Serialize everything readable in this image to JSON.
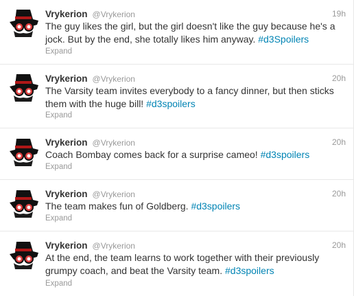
{
  "tweets": [
    {
      "fullname": "Vrykerion",
      "screenname": "@Vrykerion",
      "time": "19h",
      "text": "The guy likes the girl, but the girl doesn't like the guy because he's a jock. But by the end, she totally likes him anyway.",
      "hashtag": "#d3Spoilers",
      "expand_label": "Expand",
      "avatar_icon": "black-hat-sunglasses-avatar"
    },
    {
      "fullname": "Vrykerion",
      "screenname": "@Vrykerion",
      "time": "20h",
      "text": "The Varsity team invites everybody to a fancy dinner, but then sticks them with the huge bill!",
      "hashtag": "#d3spoilers",
      "expand_label": "Expand",
      "avatar_icon": "black-hat-sunglasses-avatar"
    },
    {
      "fullname": "Vrykerion",
      "screenname": "@Vrykerion",
      "time": "20h",
      "text": "Coach Bombay comes back for a surprise cameo!",
      "hashtag": "#d3spoilers",
      "expand_label": "Expand",
      "avatar_icon": "black-hat-sunglasses-avatar"
    },
    {
      "fullname": "Vrykerion",
      "screenname": "@Vrykerion",
      "time": "20h",
      "text": "The team makes fun of Goldberg.",
      "hashtag": "#d3spoilers",
      "expand_label": "Expand",
      "avatar_icon": "black-hat-sunglasses-avatar"
    },
    {
      "fullname": "Vrykerion",
      "screenname": "@Vrykerion",
      "time": "20h",
      "text": "At the end, the team learns to work together with their previously grumpy coach, and beat the Varsity team.",
      "hashtag": "#d3spoilers",
      "expand_label": "Expand",
      "avatar_icon": "black-hat-sunglasses-avatar"
    }
  ],
  "colors": {
    "hashtag": "#0084b4",
    "name": "#333333",
    "meta": "#999999",
    "divider": "#e8e8e8",
    "lens": "#e04040"
  }
}
